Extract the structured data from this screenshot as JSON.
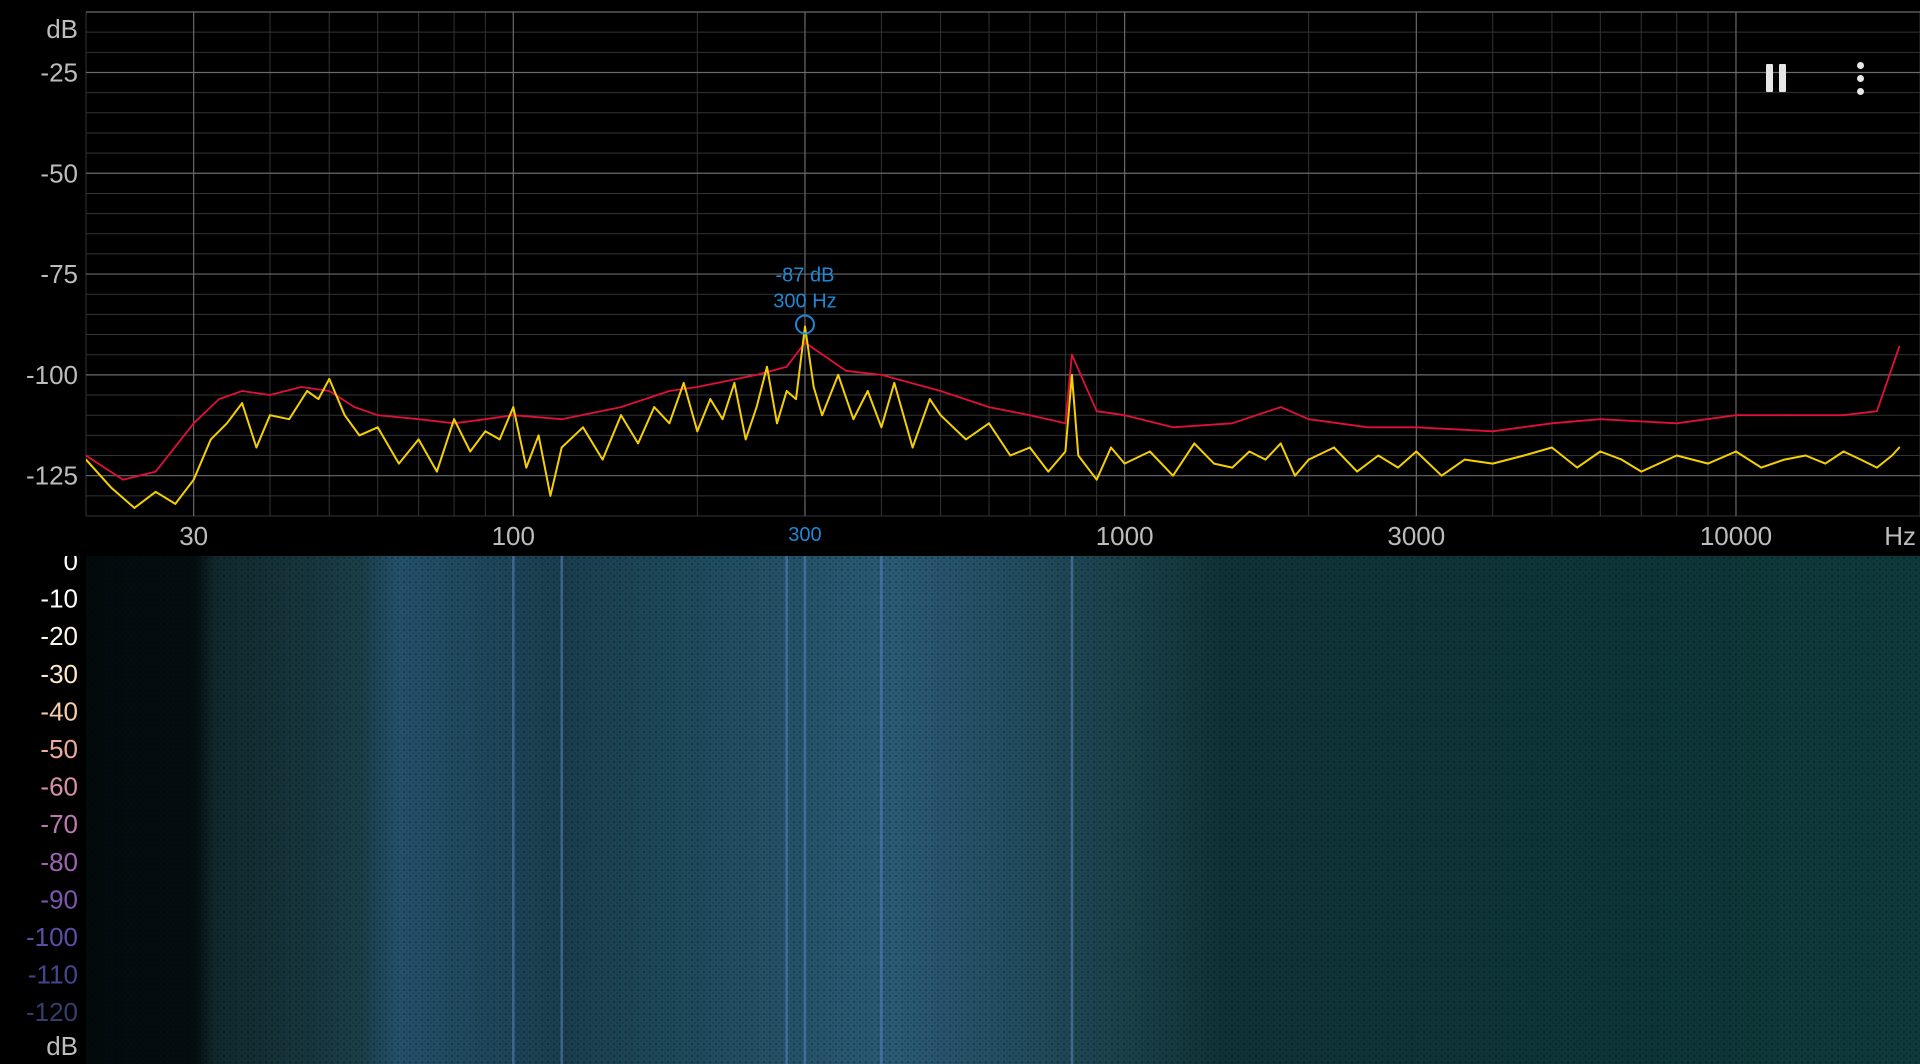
{
  "app": {
    "controls": {
      "pause_icon": "pause-icon",
      "menu_icon": "more-vert-icon"
    }
  },
  "chart_data": [
    {
      "type": "line",
      "name": "spectrum",
      "xscale": "log",
      "xlim": [
        20,
        20000
      ],
      "ylim": [
        -135,
        -10
      ],
      "ylabel": "dB",
      "xlabel": "Hz",
      "y_ticks": [
        -25,
        -50,
        -75,
        -100,
        -125
      ],
      "y_tick_labels": [
        "-25",
        "-50",
        "-75",
        "-100",
        "-125"
      ],
      "x_ticks": [
        30,
        100,
        300,
        1000,
        3000,
        10000
      ],
      "x_tick_labels": [
        "30",
        "100",
        "300",
        "1000",
        "3000",
        "10000"
      ],
      "grid": true,
      "colors": {
        "grid_major": "#6a6a6a",
        "grid_minor": "#333333",
        "axis_text": "#bdbdbd",
        "peak_hold": "#e0103a",
        "live": "#f5d000",
        "marker": "#1e88d4"
      },
      "series": [
        {
          "role": "peak-hold",
          "color": "#e0103a",
          "x": [
            20,
            23,
            26,
            30,
            33,
            36,
            40,
            45,
            50,
            55,
            60,
            70,
            80,
            90,
            100,
            120,
            150,
            180,
            200,
            250,
            280,
            300,
            350,
            400,
            500,
            600,
            700,
            800,
            820,
            900,
            1000,
            1200,
            1500,
            1800,
            2000,
            2500,
            3000,
            4000,
            5000,
            6000,
            8000,
            10000,
            12000,
            15000,
            17000,
            18500
          ],
          "y": [
            -120,
            -126,
            -124,
            -112,
            -106,
            -104,
            -105,
            -103,
            -104,
            -108,
            -110,
            -111,
            -112,
            -111,
            -110,
            -111,
            -108,
            -104,
            -103,
            -100,
            -98,
            -92,
            -99,
            -100,
            -104,
            -108,
            -110,
            -112,
            -95,
            -109,
            -110,
            -113,
            -112,
            -108,
            -111,
            -113,
            -113,
            -114,
            -112,
            -111,
            -112,
            -110,
            -110,
            -110,
            -109,
            -93
          ]
        },
        {
          "role": "live",
          "color": "#f5d000",
          "x": [
            20,
            22,
            24,
            26,
            28,
            30,
            32,
            34,
            36,
            38,
            40,
            43,
            46,
            48,
            50,
            53,
            56,
            60,
            65,
            70,
            75,
            80,
            85,
            90,
            95,
            100,
            105,
            110,
            115,
            120,
            130,
            140,
            150,
            160,
            170,
            180,
            190,
            200,
            210,
            220,
            230,
            240,
            250,
            260,
            270,
            280,
            290,
            300,
            310,
            320,
            340,
            360,
            380,
            400,
            420,
            450,
            480,
            500,
            550,
            600,
            650,
            700,
            750,
            800,
            820,
            840,
            900,
            950,
            1000,
            1100,
            1200,
            1300,
            1400,
            1500,
            1600,
            1700,
            1800,
            1900,
            2000,
            2200,
            2400,
            2600,
            2800,
            3000,
            3300,
            3600,
            4000,
            4500,
            5000,
            5500,
            6000,
            6500,
            7000,
            8000,
            9000,
            10000,
            11000,
            12000,
            13000,
            14000,
            15000,
            16000,
            17000,
            18000,
            18500
          ],
          "y": [
            -121,
            -128,
            -133,
            -129,
            -132,
            -126,
            -116,
            -112,
            -107,
            -118,
            -110,
            -111,
            -104,
            -106,
            -101,
            -110,
            -115,
            -113,
            -122,
            -116,
            -124,
            -111,
            -119,
            -114,
            -116,
            -108,
            -123,
            -115,
            -130,
            -118,
            -113,
            -121,
            -110,
            -117,
            -108,
            -112,
            -102,
            -114,
            -106,
            -111,
            -102,
            -116,
            -108,
            -98,
            -112,
            -104,
            -106,
            -88,
            -103,
            -110,
            -100,
            -111,
            -104,
            -113,
            -102,
            -118,
            -106,
            -110,
            -116,
            -112,
            -120,
            -118,
            -124,
            -119,
            -100,
            -120,
            -126,
            -118,
            -122,
            -119,
            -125,
            -117,
            -122,
            -123,
            -119,
            -121,
            -117,
            -125,
            -121,
            -118,
            -124,
            -120,
            -123,
            -119,
            -125,
            -121,
            -122,
            -120,
            -118,
            -123,
            -119,
            -121,
            -124,
            -120,
            -122,
            -119,
            -123,
            -121,
            -120,
            -122,
            -119,
            -121,
            -123,
            -120,
            -118
          ]
        }
      ],
      "marker": {
        "x": 300,
        "y": -87,
        "db_label": "-87 dB",
        "hz_label": "300 Hz",
        "axis_label": "300"
      }
    },
    {
      "type": "heatmap",
      "name": "spectrogram",
      "xscale": "log",
      "xlim": [
        20,
        20000
      ],
      "ylabel": "dB",
      "level_ticks": [
        "0",
        "-10",
        "-20",
        "-30",
        "-40",
        "-50",
        "-60",
        "-70",
        "-80",
        "-90",
        "-100",
        "-110",
        "-120"
      ],
      "level_tick_colors": [
        "#ffffff",
        "#ffffff",
        "#fff8e8",
        "#fde8c8",
        "#f7cda8",
        "#eeaa9a",
        "#d890a6",
        "#c078b0",
        "#a064b2",
        "#7e56b0",
        "#5c4ea6",
        "#43468e",
        "#343e6c"
      ],
      "lines_hz": [
        100,
        120,
        280,
        300,
        400,
        820
      ],
      "background": "#0d3a3c"
    }
  ]
}
